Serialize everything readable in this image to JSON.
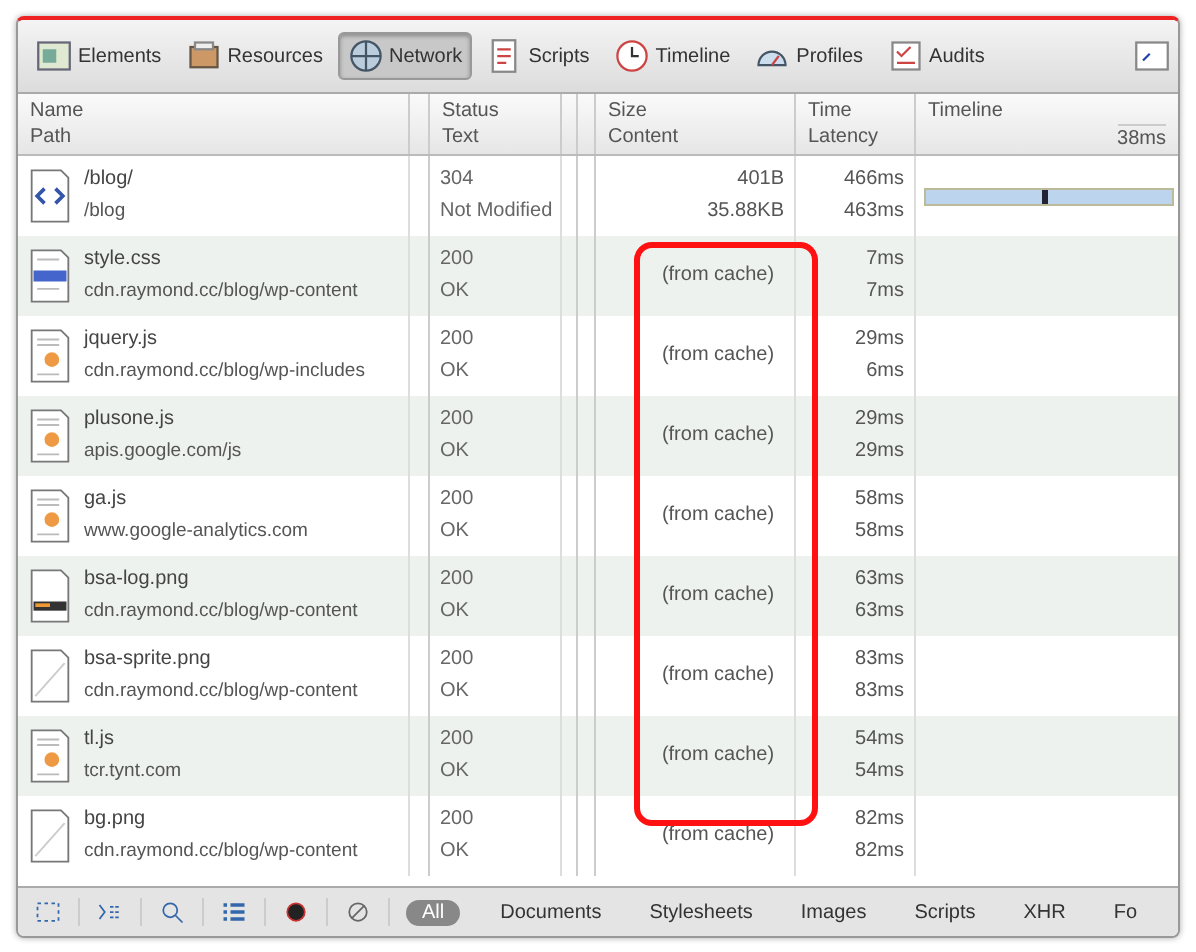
{
  "toolbar": {
    "tabs": [
      {
        "label": "Elements",
        "selected": false
      },
      {
        "label": "Resources",
        "selected": false
      },
      {
        "label": "Network",
        "selected": true
      },
      {
        "label": "Scripts",
        "selected": false
      },
      {
        "label": "Timeline",
        "selected": false
      },
      {
        "label": "Profiles",
        "selected": false
      },
      {
        "label": "Audits",
        "selected": false
      }
    ]
  },
  "table": {
    "columns": [
      {
        "top": "Name",
        "bottom": "Path"
      },
      {
        "top": "Status",
        "bottom": "Text"
      },
      {
        "top": "Size",
        "bottom": "Content"
      },
      {
        "top": "Time",
        "bottom": "Latency"
      },
      {
        "top": "Timeline",
        "bottom": "38ms"
      }
    ],
    "rows": [
      {
        "kind": "html",
        "name": "/blog/",
        "path": "/blog",
        "status": "304",
        "text": "Not Modified",
        "size": "401B",
        "content": "35.88KB",
        "time": "466ms",
        "latency": "463ms",
        "level": 1
      },
      {
        "kind": "css",
        "name": "style.css",
        "path": "cdn.raymond.cc/blog/wp-content",
        "status": "200",
        "text": "OK",
        "size": "(from cache)",
        "time": "7ms",
        "latency": "7ms"
      },
      {
        "kind": "js",
        "name": "jquery.js",
        "path": "cdn.raymond.cc/blog/wp-includes",
        "status": "200",
        "text": "OK",
        "size": "(from cache)",
        "time": "29ms",
        "latency": "6ms"
      },
      {
        "kind": "js",
        "name": "plusone.js",
        "path": "apis.google.com/js",
        "status": "200",
        "text": "OK",
        "size": "(from cache)",
        "time": "29ms",
        "latency": "29ms"
      },
      {
        "kind": "js",
        "name": "ga.js",
        "path": "www.google-analytics.com",
        "status": "200",
        "text": "OK",
        "size": "(from cache)",
        "time": "58ms",
        "latency": "58ms"
      },
      {
        "kind": "image",
        "name": "bsa-log.png",
        "path": "cdn.raymond.cc/blog/wp-content",
        "status": "200",
        "text": "OK",
        "size": "(from cache)",
        "time": "63ms",
        "latency": "63ms"
      },
      {
        "kind": "blank",
        "name": "bsa-sprite.png",
        "path": "cdn.raymond.cc/blog/wp-content",
        "status": "200",
        "text": "OK",
        "size": "(from cache)",
        "time": "83ms",
        "latency": "83ms"
      },
      {
        "kind": "js",
        "name": "tl.js",
        "path": "tcr.tynt.com",
        "status": "200",
        "text": "OK",
        "size": "(from cache)",
        "time": "54ms",
        "latency": "54ms"
      },
      {
        "kind": "blank",
        "name": "bg.png",
        "path": "cdn.raymond.cc/blog/wp-content",
        "status": "200",
        "text": "OK",
        "size": "(from cache)",
        "time": "82ms",
        "latency": "82ms"
      }
    ]
  },
  "status_bar": {
    "filters": [
      {
        "label": "All",
        "selected": true
      },
      {
        "label": "Documents",
        "selected": false
      },
      {
        "label": "Stylesheets",
        "selected": false
      },
      {
        "label": "Images",
        "selected": false
      },
      {
        "label": "Scripts",
        "selected": false
      },
      {
        "label": "XHR",
        "selected": false
      },
      {
        "label": "Fo",
        "selected": false
      }
    ]
  }
}
